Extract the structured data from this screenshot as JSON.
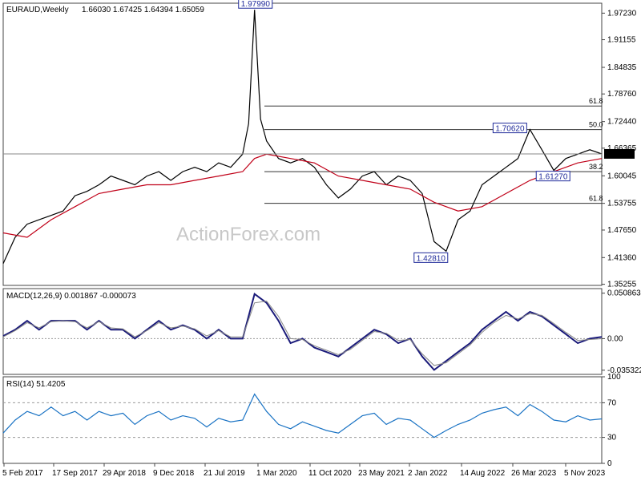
{
  "header": {
    "title": "EURAUD,Weekly",
    "ohlc": "1.66030 1.67425 1.64394 1.65059"
  },
  "watermark": "ActionForex.com",
  "chart_data": [
    {
      "type": "line",
      "title": "EURAUD,Weekly",
      "ylim": [
        1.35,
        1.995
      ],
      "y_ticks": [
        "1.97230",
        "1.91155",
        "1.84835",
        "1.78760",
        "1.72440",
        "1.66365",
        "1.60045",
        "1.53755",
        "1.47650",
        "1.41360",
        "1.35255"
      ],
      "y_tick_values": [
        1.9723,
        1.91155,
        1.84835,
        1.7876,
        1.7244,
        1.66365,
        1.60045,
        1.53755,
        1.4765,
        1.4136,
        1.35255
      ],
      "x_ticks": [
        "5 Feb 2017",
        "17 Sep 2017",
        "29 Apr 2018",
        "9 Dec 2018",
        "21 Jul 2019",
        "1 Mar 2020",
        "11 Oct 2020",
        "23 May 2021",
        "2 Jan 2022",
        "14 Aug 2022",
        "26 Mar 2023",
        "5 Nov 2023"
      ],
      "current_price": "1.65059",
      "price_points": [
        [
          0,
          1.4
        ],
        [
          10,
          1.46
        ],
        [
          20,
          1.49
        ],
        [
          30,
          1.5
        ],
        [
          40,
          1.51
        ],
        [
          50,
          1.52
        ],
        [
          60,
          1.555
        ],
        [
          70,
          1.565
        ],
        [
          80,
          1.58
        ],
        [
          90,
          1.6
        ],
        [
          100,
          1.59
        ],
        [
          110,
          1.58
        ],
        [
          120,
          1.6
        ],
        [
          130,
          1.61
        ],
        [
          140,
          1.59
        ],
        [
          150,
          1.61
        ],
        [
          160,
          1.62
        ],
        [
          170,
          1.61
        ],
        [
          180,
          1.63
        ],
        [
          190,
          1.62
        ],
        [
          200,
          1.65
        ],
        [
          205,
          1.72
        ],
        [
          210,
          1.9799
        ],
        [
          215,
          1.73
        ],
        [
          220,
          1.68
        ],
        [
          230,
          1.64
        ],
        [
          240,
          1.63
        ],
        [
          250,
          1.64
        ],
        [
          260,
          1.62
        ],
        [
          270,
          1.58
        ],
        [
          280,
          1.55
        ],
        [
          290,
          1.57
        ],
        [
          300,
          1.6
        ],
        [
          310,
          1.61
        ],
        [
          320,
          1.58
        ],
        [
          330,
          1.6
        ],
        [
          340,
          1.59
        ],
        [
          350,
          1.56
        ],
        [
          360,
          1.45
        ],
        [
          370,
          1.4281
        ],
        [
          380,
          1.5
        ],
        [
          390,
          1.52
        ],
        [
          400,
          1.58
        ],
        [
          410,
          1.6
        ],
        [
          420,
          1.62
        ],
        [
          430,
          1.64
        ],
        [
          440,
          1.7062
        ],
        [
          450,
          1.66
        ],
        [
          460,
          1.6127
        ],
        [
          470,
          1.64
        ],
        [
          480,
          1.65
        ],
        [
          490,
          1.66
        ],
        [
          500,
          1.65059
        ]
      ],
      "moving_average": [
        [
          0,
          1.47
        ],
        [
          20,
          1.46
        ],
        [
          40,
          1.5
        ],
        [
          60,
          1.53
        ],
        [
          80,
          1.56
        ],
        [
          100,
          1.57
        ],
        [
          120,
          1.58
        ],
        [
          140,
          1.58
        ],
        [
          160,
          1.59
        ],
        [
          180,
          1.6
        ],
        [
          200,
          1.61
        ],
        [
          210,
          1.64
        ],
        [
          220,
          1.65
        ],
        [
          240,
          1.64
        ],
        [
          260,
          1.63
        ],
        [
          280,
          1.6
        ],
        [
          300,
          1.59
        ],
        [
          320,
          1.58
        ],
        [
          340,
          1.57
        ],
        [
          360,
          1.54
        ],
        [
          380,
          1.52
        ],
        [
          400,
          1.53
        ],
        [
          420,
          1.56
        ],
        [
          440,
          1.59
        ],
        [
          460,
          1.61
        ],
        [
          480,
          1.63
        ],
        [
          500,
          1.64
        ]
      ],
      "fibonacci": [
        {
          "label": "61.8",
          "value": 1.76
        },
        {
          "label": "50.0",
          "value": 1.7062
        },
        {
          "label": "38.2",
          "value": 1.61
        },
        {
          "label": "61.8",
          "value": 1.5375
        }
      ],
      "point_labels": [
        {
          "text": "1.97990",
          "x": 210,
          "y": 1.9799
        },
        {
          "text": "1.70620",
          "x": 440,
          "y": 1.7062
        },
        {
          "text": "1.61270",
          "x": 460,
          "y": 1.6127
        },
        {
          "text": "1.42810",
          "x": 370,
          "y": 1.4281
        }
      ]
    },
    {
      "type": "line",
      "title": "MACD(12,26,9) 0.001867 -0.000073",
      "ylim": [
        -0.04,
        0.056
      ],
      "y_ticks": [
        "0.050863",
        "0.00",
        "-0.035322"
      ],
      "y_tick_values": [
        0.050863,
        0,
        -0.035322
      ],
      "series": [
        {
          "values": [
            [
              0,
              0.003
            ],
            [
              10,
              0.01
            ],
            [
              20,
              0.02
            ],
            [
              30,
              0.01
            ],
            [
              40,
              0.02
            ],
            [
              50,
              0.02
            ],
            [
              60,
              0.02
            ],
            [
              70,
              0.01
            ],
            [
              80,
              0.02
            ],
            [
              90,
              0.01
            ],
            [
              100,
              0.01
            ],
            [
              110,
              0.0
            ],
            [
              120,
              0.01
            ],
            [
              130,
              0.02
            ],
            [
              140,
              0.01
            ],
            [
              150,
              0.015
            ],
            [
              160,
              0.01
            ],
            [
              170,
              0.0
            ],
            [
              180,
              0.01
            ],
            [
              190,
              0.0
            ],
            [
              200,
              0.0
            ],
            [
              210,
              0.05
            ],
            [
              220,
              0.04
            ],
            [
              230,
              0.02
            ],
            [
              240,
              -0.005
            ],
            [
              250,
              0.0
            ],
            [
              260,
              -0.01
            ],
            [
              270,
              -0.015
            ],
            [
              280,
              -0.02
            ],
            [
              290,
              -0.01
            ],
            [
              300,
              0.0
            ],
            [
              310,
              0.01
            ],
            [
              320,
              0.005
            ],
            [
              330,
              -0.005
            ],
            [
              340,
              0.0
            ],
            [
              350,
              -0.02
            ],
            [
              360,
              -0.035
            ],
            [
              370,
              -0.025
            ],
            [
              380,
              -0.015
            ],
            [
              390,
              -0.005
            ],
            [
              400,
              0.01
            ],
            [
              410,
              0.02
            ],
            [
              420,
              0.03
            ],
            [
              430,
              0.02
            ],
            [
              440,
              0.03
            ],
            [
              450,
              0.025
            ],
            [
              460,
              0.015
            ],
            [
              470,
              0.005
            ],
            [
              480,
              -0.005
            ],
            [
              490,
              0.0
            ],
            [
              500,
              0.0019
            ]
          ]
        },
        {
          "values": [
            [
              0,
              0.002
            ],
            [
              10,
              0.009
            ],
            [
              20,
              0.018
            ],
            [
              30,
              0.012
            ],
            [
              40,
              0.019
            ],
            [
              50,
              0.02
            ],
            [
              60,
              0.019
            ],
            [
              70,
              0.012
            ],
            [
              80,
              0.019
            ],
            [
              90,
              0.012
            ],
            [
              100,
              0.011
            ],
            [
              110,
              0.002
            ],
            [
              120,
              0.009
            ],
            [
              130,
              0.018
            ],
            [
              140,
              0.012
            ],
            [
              150,
              0.014
            ],
            [
              160,
              0.011
            ],
            [
              170,
              0.003
            ],
            [
              180,
              0.009
            ],
            [
              190,
              0.002
            ],
            [
              200,
              0.002
            ],
            [
              210,
              0.04
            ],
            [
              220,
              0.042
            ],
            [
              230,
              0.025
            ],
            [
              240,
              0.0
            ],
            [
              250,
              -0.001
            ],
            [
              260,
              -0.008
            ],
            [
              270,
              -0.013
            ],
            [
              280,
              -0.018
            ],
            [
              290,
              -0.012
            ],
            [
              300,
              -0.002
            ],
            [
              310,
              0.008
            ],
            [
              320,
              0.006
            ],
            [
              330,
              -0.002
            ],
            [
              340,
              -0.001
            ],
            [
              350,
              -0.017
            ],
            [
              360,
              -0.03
            ],
            [
              370,
              -0.027
            ],
            [
              380,
              -0.017
            ],
            [
              390,
              -0.007
            ],
            [
              400,
              0.007
            ],
            [
              410,
              0.018
            ],
            [
              420,
              0.026
            ],
            [
              430,
              0.022
            ],
            [
              440,
              0.028
            ],
            [
              450,
              0.026
            ],
            [
              460,
              0.017
            ],
            [
              470,
              0.007
            ],
            [
              480,
              -0.002
            ],
            [
              490,
              -0.001
            ],
            [
              500,
              -7.3e-05
            ]
          ]
        }
      ]
    },
    {
      "type": "line",
      "title": "RSI(14) 51.4205",
      "ylim": [
        0,
        100
      ],
      "y_ticks": [
        "100",
        "70",
        "30",
        "0"
      ],
      "y_tick_values": [
        100,
        70,
        30,
        0
      ],
      "series": [
        {
          "values": [
            [
              0,
              35
            ],
            [
              10,
              50
            ],
            [
              20,
              60
            ],
            [
              30,
              55
            ],
            [
              40,
              65
            ],
            [
              50,
              55
            ],
            [
              60,
              60
            ],
            [
              70,
              50
            ],
            [
              80,
              60
            ],
            [
              90,
              55
            ],
            [
              100,
              58
            ],
            [
              110,
              45
            ],
            [
              120,
              55
            ],
            [
              130,
              60
            ],
            [
              140,
              50
            ],
            [
              150,
              55
            ],
            [
              160,
              52
            ],
            [
              170,
              42
            ],
            [
              180,
              52
            ],
            [
              190,
              48
            ],
            [
              200,
              50
            ],
            [
              210,
              80
            ],
            [
              220,
              60
            ],
            [
              230,
              45
            ],
            [
              240,
              40
            ],
            [
              250,
              48
            ],
            [
              260,
              43
            ],
            [
              270,
              38
            ],
            [
              280,
              35
            ],
            [
              290,
              45
            ],
            [
              300,
              55
            ],
            [
              310,
              58
            ],
            [
              320,
              45
            ],
            [
              330,
              52
            ],
            [
              340,
              50
            ],
            [
              350,
              40
            ],
            [
              360,
              30
            ],
            [
              370,
              38
            ],
            [
              380,
              45
            ],
            [
              390,
              50
            ],
            [
              400,
              58
            ],
            [
              410,
              62
            ],
            [
              420,
              65
            ],
            [
              430,
              55
            ],
            [
              440,
              68
            ],
            [
              450,
              60
            ],
            [
              460,
              50
            ],
            [
              470,
              48
            ],
            [
              480,
              55
            ],
            [
              490,
              50
            ],
            [
              500,
              51.4205
            ]
          ]
        }
      ]
    }
  ],
  "colors": {
    "price": "#000000",
    "ma": "#c00018",
    "macd": "#1b1b7a",
    "signal": "#888888",
    "rsi": "#1a73c4",
    "grid": "#999999",
    "label_border": "#1f2a9a"
  }
}
